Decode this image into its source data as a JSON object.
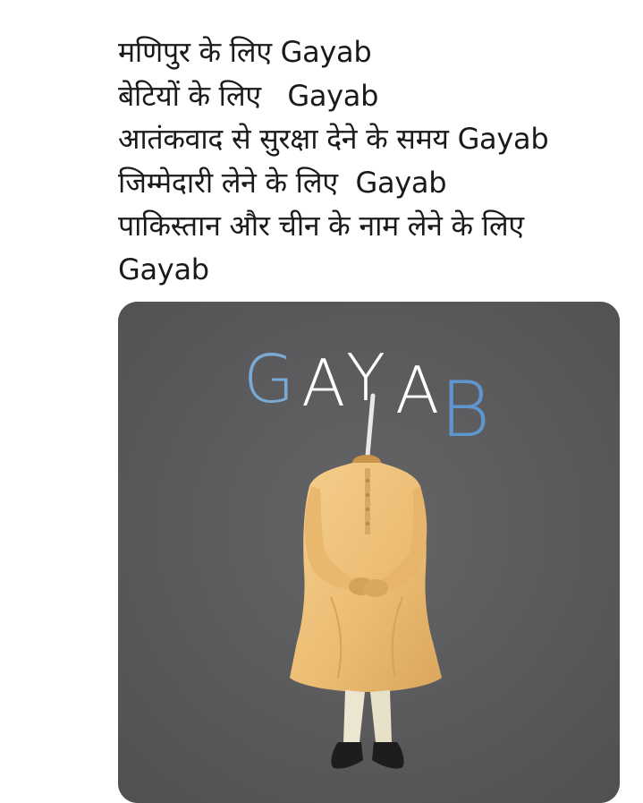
{
  "post": {
    "lines": [
      "मणिपुर के लिए Gayab",
      "बेटियों के लिए   Gayab",
      "आतंकवाद से सुरक्षा देने के समय Gayab",
      "जिम्मेदारी लेने के लिए  Gayab",
      "पाकिस्तान और चीन के नाम लेने के लिए",
      "Gayab"
    ]
  },
  "image": {
    "title_letters": [
      "G",
      "A",
      "Y",
      "A",
      "B"
    ],
    "background_color": "#5b5b5d",
    "kurta_color": "#eec27a",
    "title_colors": [
      "#7aa9d6",
      "#ffffff",
      "#ffffff",
      "#ffffff",
      "#5e97d0"
    ]
  }
}
